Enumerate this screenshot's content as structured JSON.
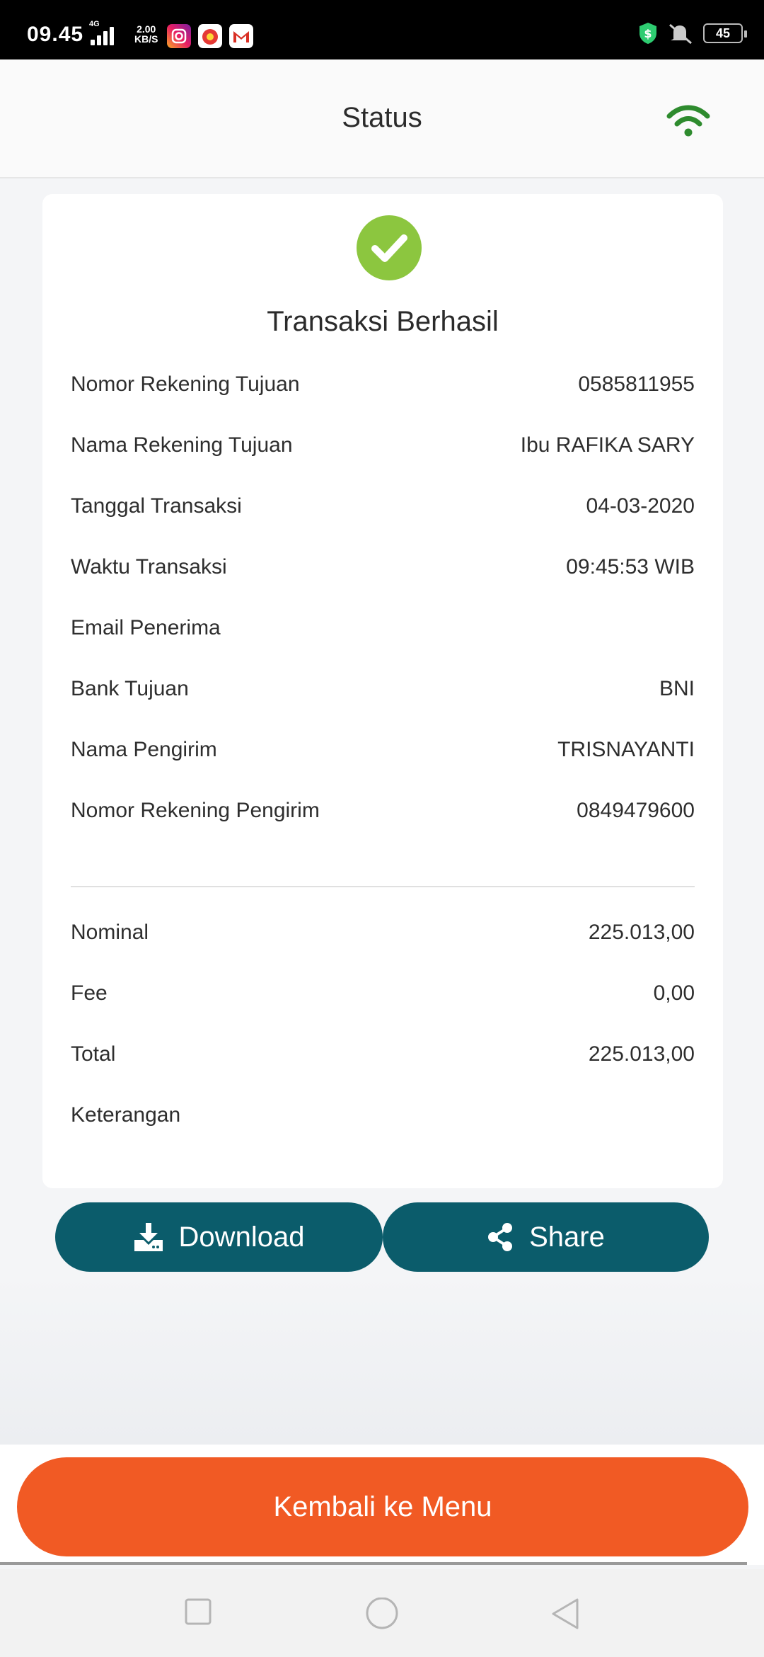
{
  "status_bar": {
    "time": "09.45",
    "network": "4G",
    "speed_value": "2.00",
    "speed_unit": "KB/S",
    "battery": "45",
    "icons": [
      "instagram-icon",
      "game-app-icon",
      "gmail-icon",
      "shield-icon",
      "mute-icon",
      "battery-icon"
    ]
  },
  "header": {
    "title": "Status",
    "wifi_color": "#2e8b2e"
  },
  "receipt": {
    "status_title": "Transaksi Berhasil",
    "success_color": "#8cc63f",
    "details": [
      {
        "label": "Nomor Rekening Tujuan",
        "value": "0585811955"
      },
      {
        "label": "Nama Rekening Tujuan",
        "value": "Ibu RAFIKA SARY"
      },
      {
        "label": "Tanggal Transaksi",
        "value": "04-03-2020"
      },
      {
        "label": "Waktu Transaksi",
        "value": "09:45:53 WIB"
      },
      {
        "label": "Email Penerima",
        "value": ""
      },
      {
        "label": "Bank Tujuan",
        "value": "BNI"
      },
      {
        "label": "Nama Pengirim",
        "value": "TRISNAYANTI"
      },
      {
        "label": "Nomor Rekening Pengirim",
        "value": "0849479600"
      }
    ],
    "amounts": [
      {
        "label": "Nominal",
        "value": "225.013,00"
      },
      {
        "label": "Fee",
        "value": "0,00"
      },
      {
        "label": "Total",
        "value": "225.013,00"
      },
      {
        "label": "Keterangan",
        "value": ""
      }
    ]
  },
  "actions": {
    "download_label": "Download",
    "share_label": "Share",
    "button_color": "#0b5c6b"
  },
  "footer": {
    "menu_label": "Kembali ke Menu",
    "menu_color": "#f15a24"
  }
}
